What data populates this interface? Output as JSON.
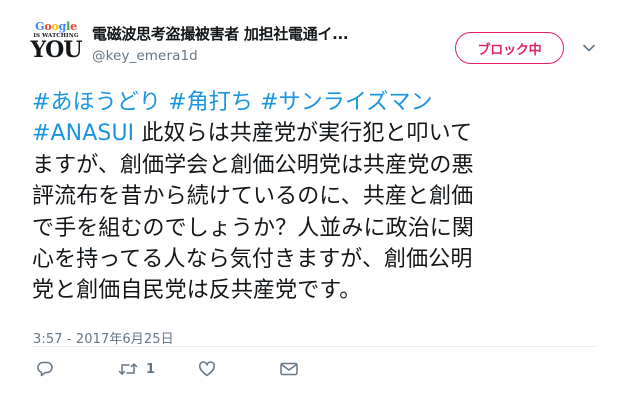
{
  "user": {
    "display_name": "電磁波思考盗撮被害者 加担社電通イ...",
    "username": "@key_emera1d",
    "avatar": {
      "line1": "Google",
      "line2": "IS WATCHING",
      "line3": "YOU"
    }
  },
  "block_button": {
    "label": "ブロック中"
  },
  "tweet": {
    "hashtags": [
      "#あほうどり",
      "#角打ち",
      "#サンライズマン",
      "#ANASUI"
    ],
    "text_lines": [
      "此奴らは共産党が実行犯と叩いて",
      "ますが、創価学会と創価公明党は共産党の悪",
      "評流布を昔から続けているのに、共産と創価",
      "で手を組むのでしょうか？人並みに政治に関",
      "心を持ってる人なら気付きますが、創価公明",
      "党と創価自民党は反共産党です。"
    ],
    "timestamp": "3:57 - 2017年6月25日"
  },
  "actions": {
    "reply_icon": "reply-icon",
    "retweet_icon": "retweet-icon",
    "retweet_count": "1",
    "like_icon": "heart-icon",
    "message_icon": "envelope-icon"
  },
  "colors": {
    "hashtag": "#1b95e0",
    "block_accent": "#e0245e",
    "secondary_text": "#657786"
  }
}
